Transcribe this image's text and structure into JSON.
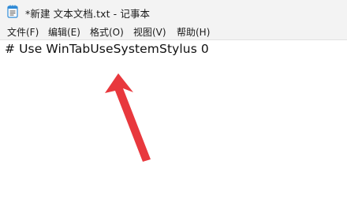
{
  "window": {
    "title": "*新建 文本文档.txt - 记事本",
    "icon": "notepad-icon"
  },
  "menu": {
    "items": [
      {
        "label": "文件(F)"
      },
      {
        "label": "编辑(E)"
      },
      {
        "label": "格式(O)"
      },
      {
        "label": "视图(V)"
      },
      {
        "label": "帮助(H)"
      }
    ]
  },
  "editor": {
    "content": "# Use WinTabUseSystemStylus 0"
  },
  "annotation": {
    "icon": "red-arrow-icon",
    "color": "#e8383d"
  },
  "colors": {
    "titlebar_bg": "#f3f3f3",
    "editor_bg": "#ffffff",
    "icon_accent": "#2f8ad6"
  }
}
